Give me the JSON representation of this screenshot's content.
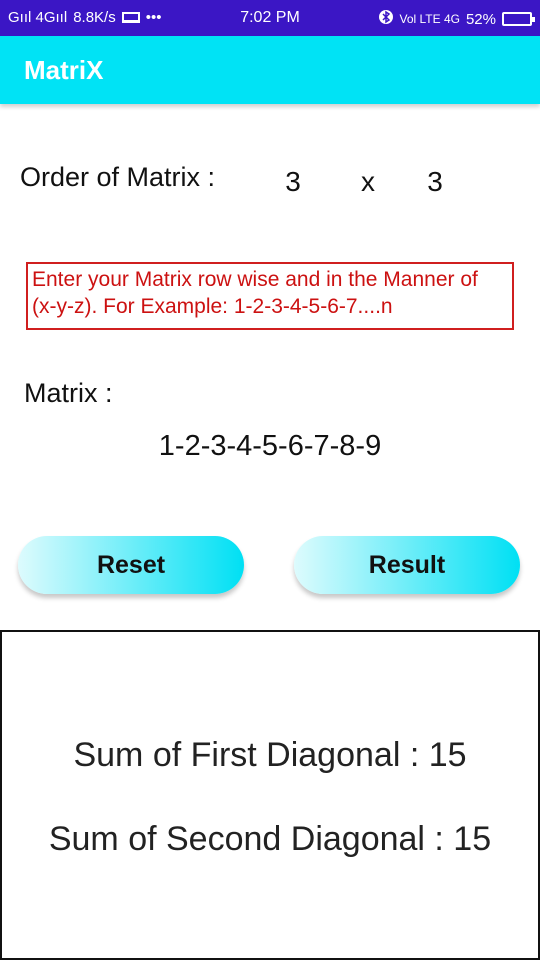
{
  "status_bar": {
    "signal": "Gııl 4Gııl",
    "speed": "8.8K/s",
    "dots": "•••",
    "time": "7:02 PM",
    "network": "Vol LTE 4G",
    "battery": "52%"
  },
  "app": {
    "title": "MatriX"
  },
  "order": {
    "label": "Order of Matrix :",
    "rows": "3",
    "separator": "x",
    "cols": "3"
  },
  "hint": {
    "text": " Enter your Matrix  row wise and in the Manner of (x-y-z).  For Example: 1-2-3-4-5-6-7....n",
    "color": "#cc1111"
  },
  "matrix": {
    "label": "Matrix :",
    "value": "1-2-3-4-5-6-7-8-9"
  },
  "buttons": {
    "reset": "Reset",
    "result": "Result"
  },
  "results": {
    "first_diagonal": "Sum of First Diagonal : 15",
    "second_diagonal": "Sum of Second Diagonal : 15"
  },
  "colors": {
    "status_bar": "#3b16c5",
    "app_bar": "#00e3f5",
    "button_gradient_end": "#00e0f4"
  },
  "icons": [
    "laptop-icon",
    "bluetooth-icon",
    "battery-icon"
  ]
}
